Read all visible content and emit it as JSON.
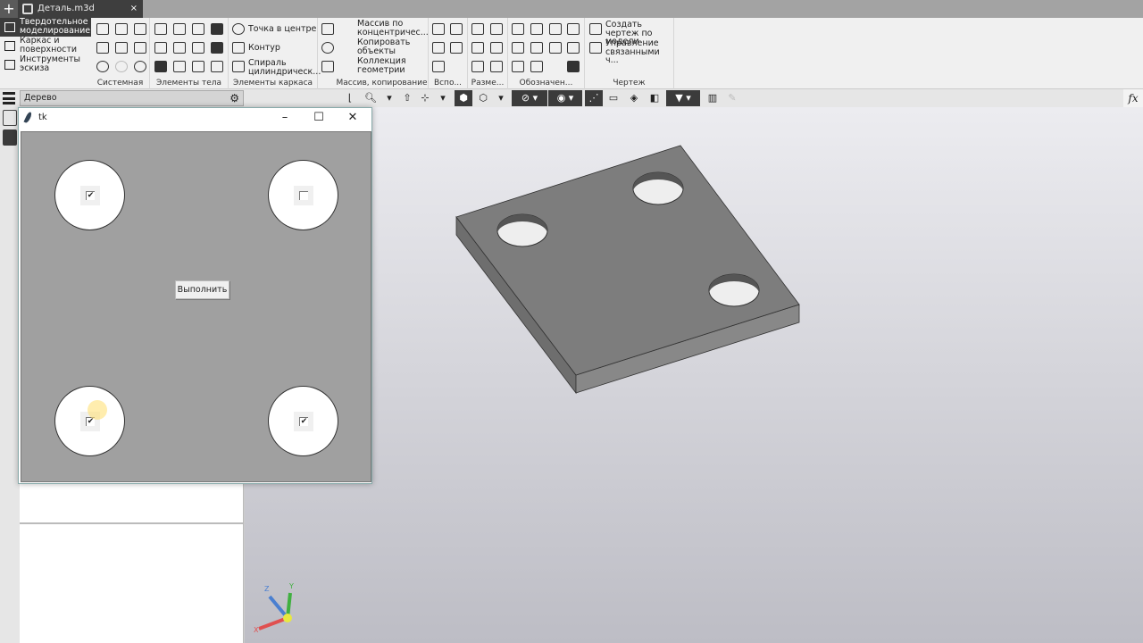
{
  "tabbar": {
    "plus": "+",
    "document_tab": "Деталь.m3d",
    "close": "×"
  },
  "ribbon": {
    "modes": [
      "Твердотельное моделирование",
      "Каркас и поверхности",
      "Инструменты эскиза"
    ],
    "groups": {
      "system": "Системная",
      "body": "Элементы тела",
      "wire": "Элементы каркаса",
      "copy": "Массив, копирование",
      "aux": "Вспо...",
      "dims": "Разме...",
      "marks": "Обозначен...",
      "drawing": "Чертеж"
    },
    "wire_items": [
      "Точка в центре",
      "Контур",
      "Спираль цилиндрическ..."
    ],
    "copy_items": [
      "Массив по концентричес...",
      "Копировать объекты",
      "Коллекция геометрии"
    ],
    "drawing_items": [
      "Создать чертеж по модели",
      "Управление связанными ч..."
    ]
  },
  "tree": {
    "header": "Дерево"
  },
  "formula_label": "fx",
  "tk": {
    "title": "tk",
    "minimize": "–",
    "maximize": "☐",
    "close": "✕",
    "checkboxes": [
      {
        "checked": true,
        "mark": "✔"
      },
      {
        "checked": false,
        "mark": ""
      },
      {
        "checked": true,
        "mark": "✔"
      },
      {
        "checked": true,
        "mark": "✔"
      }
    ],
    "button": "Выполнить"
  },
  "triad": {
    "x": "X",
    "y": "Y",
    "z": "Z"
  },
  "colors": {
    "dark": "#3b3b3b",
    "viewport_top": "#ececf0",
    "viewport_bottom": "#bdbdc5",
    "canvas": "#a0a0a0"
  }
}
